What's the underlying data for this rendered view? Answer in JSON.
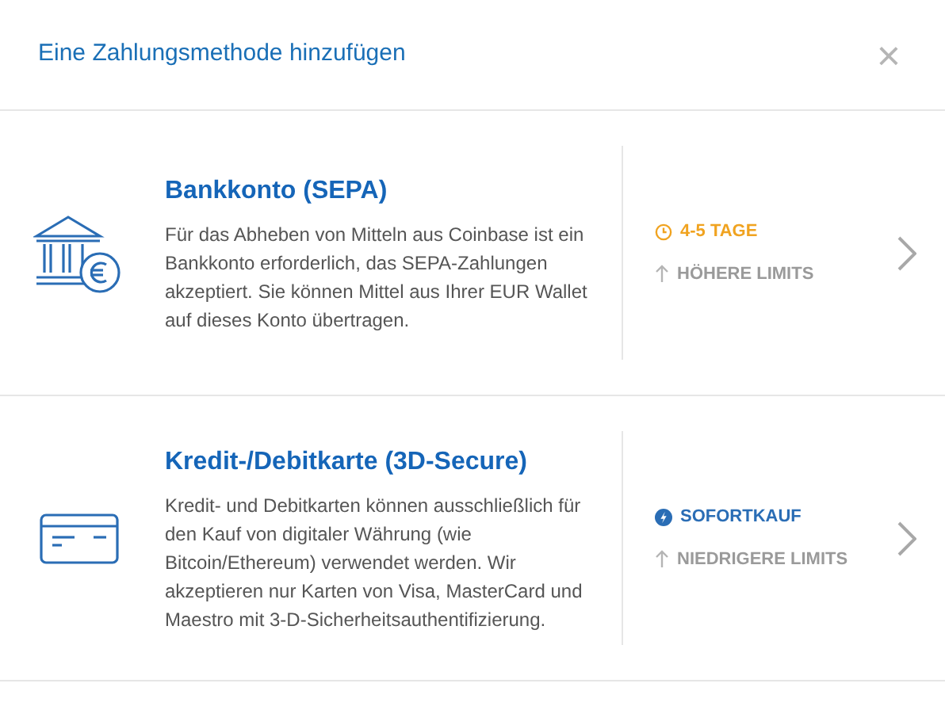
{
  "dialog": {
    "title": "Eine Zahlungsmethode hinzufügen",
    "close": "×"
  },
  "methods": [
    {
      "kind": "bank",
      "title": "Bankkonto (SEPA)",
      "description": "Für das Abheben von Mitteln aus Coinbase ist ein Bankkonto erforderlich, das SEPA-Zahlungen akzeptiert. Sie können Mittel aus Ihrer EUR Wallet auf dieses Konto übertragen.",
      "speed": {
        "kind": "time",
        "label": "4-5 TAGE"
      },
      "limits": "HÖHERE LIMITS"
    },
    {
      "kind": "card",
      "title": "Kredit-/Debitkarte (3D-Secure)",
      "description": "Kredit- und Debitkarten können ausschließlich für den Kauf von digitaler Währung (wie Bitcoin/Ethereum) verwendet werden. Wir akzeptieren nur Karten von Visa, MasterCard und Maestro mit 3-D-Sicherheitsauthentifizierung.",
      "speed": {
        "kind": "instant",
        "label": "SOFORTKAUF"
      },
      "limits": "NIEDRIGERE LIMITS"
    }
  ]
}
